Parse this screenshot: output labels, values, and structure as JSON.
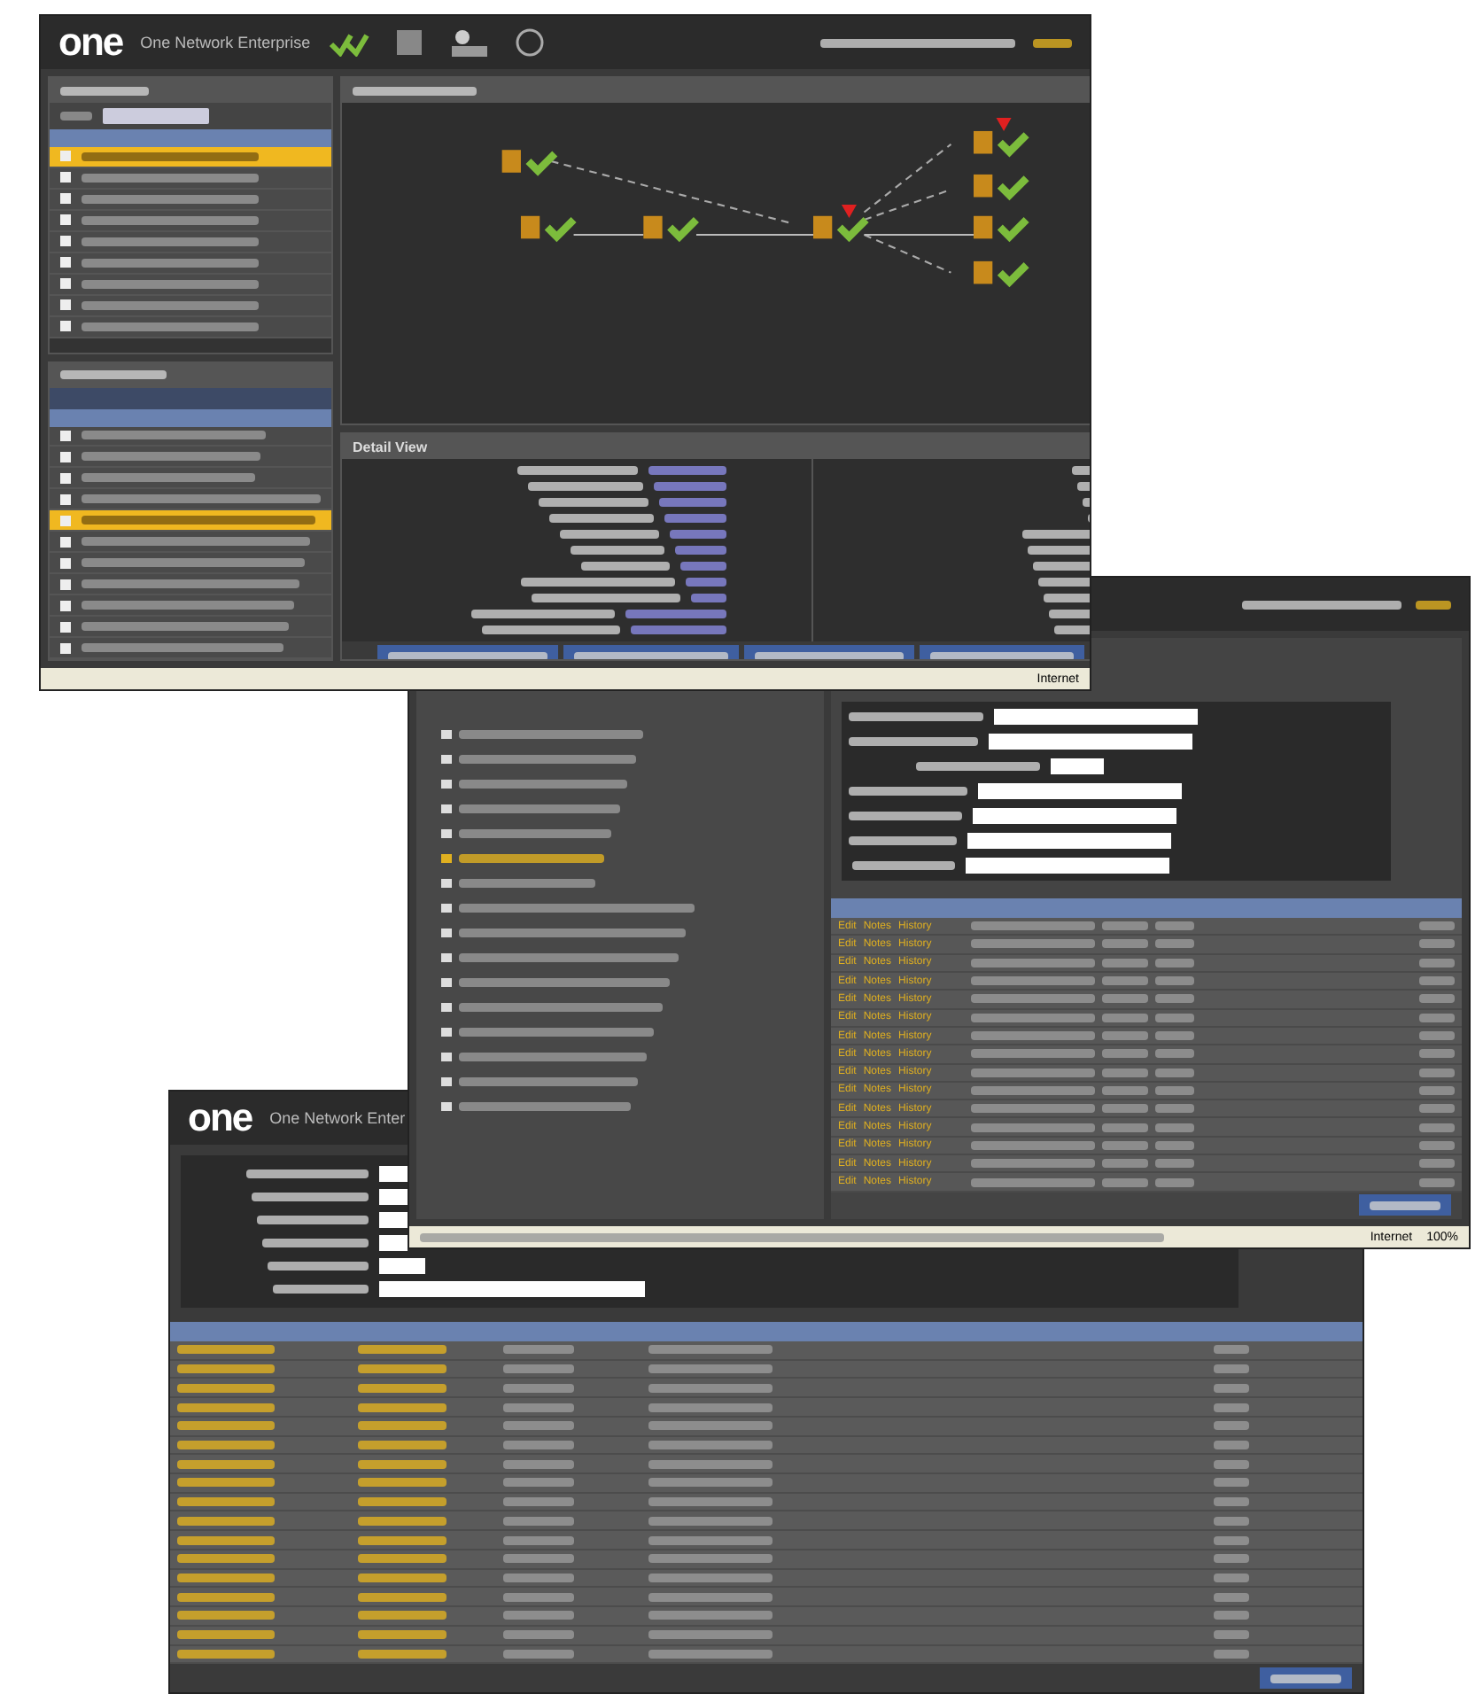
{
  "windows": [
    {
      "kind": "planner",
      "logo": "one",
      "title": "One Network Enterprise",
      "item_rows": [
        {
          "selected": true
        },
        {
          "selected": false
        },
        {
          "selected": false
        },
        {
          "selected": false
        },
        {
          "selected": false
        },
        {
          "selected": false
        },
        {
          "selected": false
        },
        {
          "selected": false
        },
        {
          "selected": false
        }
      ],
      "alert_rows": [
        {
          "selected": false
        },
        {
          "selected": false
        },
        {
          "selected": false
        },
        {
          "selected": false
        },
        {
          "selected": true
        },
        {
          "selected": false
        },
        {
          "selected": false
        },
        {
          "selected": false
        },
        {
          "selected": false
        },
        {
          "selected": false
        },
        {
          "selected": false
        }
      ],
      "detail_title": "Detail View",
      "status": "Internet"
    },
    {
      "kind": "search",
      "status": "Internet",
      "zoom": "100%",
      "tree": [
        {
          "selected": false
        },
        {
          "selected": false
        },
        {
          "selected": false
        },
        {
          "selected": false
        },
        {
          "selected": false
        },
        {
          "selected": true
        },
        {
          "selected": false
        },
        {
          "selected": false
        },
        {
          "selected": false
        },
        {
          "selected": false
        },
        {
          "selected": false
        },
        {
          "selected": false
        },
        {
          "selected": false
        },
        {
          "selected": false
        },
        {
          "selected": false
        },
        {
          "selected": false
        }
      ],
      "rows": [
        {
          "links": [
            "Edit",
            "Notes",
            "History"
          ]
        },
        {
          "links": [
            "Edit",
            "Notes",
            "History"
          ]
        },
        {
          "links": [
            "Edit",
            "Notes",
            "History"
          ]
        },
        {
          "links": [
            "Edit",
            "Notes",
            "History"
          ]
        },
        {
          "links": [
            "Edit",
            "Notes",
            "History"
          ]
        },
        {
          "links": [
            "Edit",
            "Notes",
            "History"
          ]
        },
        {
          "links": [
            "Edit",
            "Notes",
            "History"
          ]
        },
        {
          "links": [
            "Edit",
            "Notes",
            "History"
          ]
        },
        {
          "links": [
            "Edit",
            "Notes",
            "History"
          ]
        },
        {
          "links": [
            "Edit",
            "Notes",
            "History"
          ]
        },
        {
          "links": [
            "Edit",
            "Notes",
            "History"
          ]
        },
        {
          "links": [
            "Edit",
            "Notes",
            "History"
          ]
        },
        {
          "links": [
            "Edit",
            "Notes",
            "History"
          ]
        },
        {
          "links": [
            "Edit",
            "Notes",
            "History"
          ]
        },
        {
          "links": [
            "Edit",
            "Notes",
            "History"
          ]
        }
      ]
    },
    {
      "kind": "list",
      "logo": "one",
      "title": "One Network Enter",
      "rows": [
        {
          "selected": false
        },
        {
          "selected": false
        },
        {
          "selected": false
        },
        {
          "selected": false
        },
        {
          "selected": false
        },
        {
          "selected": false
        },
        {
          "selected": false
        },
        {
          "selected": false
        },
        {
          "selected": false
        },
        {
          "selected": false
        },
        {
          "selected": false
        },
        {
          "selected": false
        },
        {
          "selected": false
        },
        {
          "selected": false
        },
        {
          "selected": false
        },
        {
          "selected": false
        },
        {
          "selected": false
        }
      ]
    }
  ]
}
